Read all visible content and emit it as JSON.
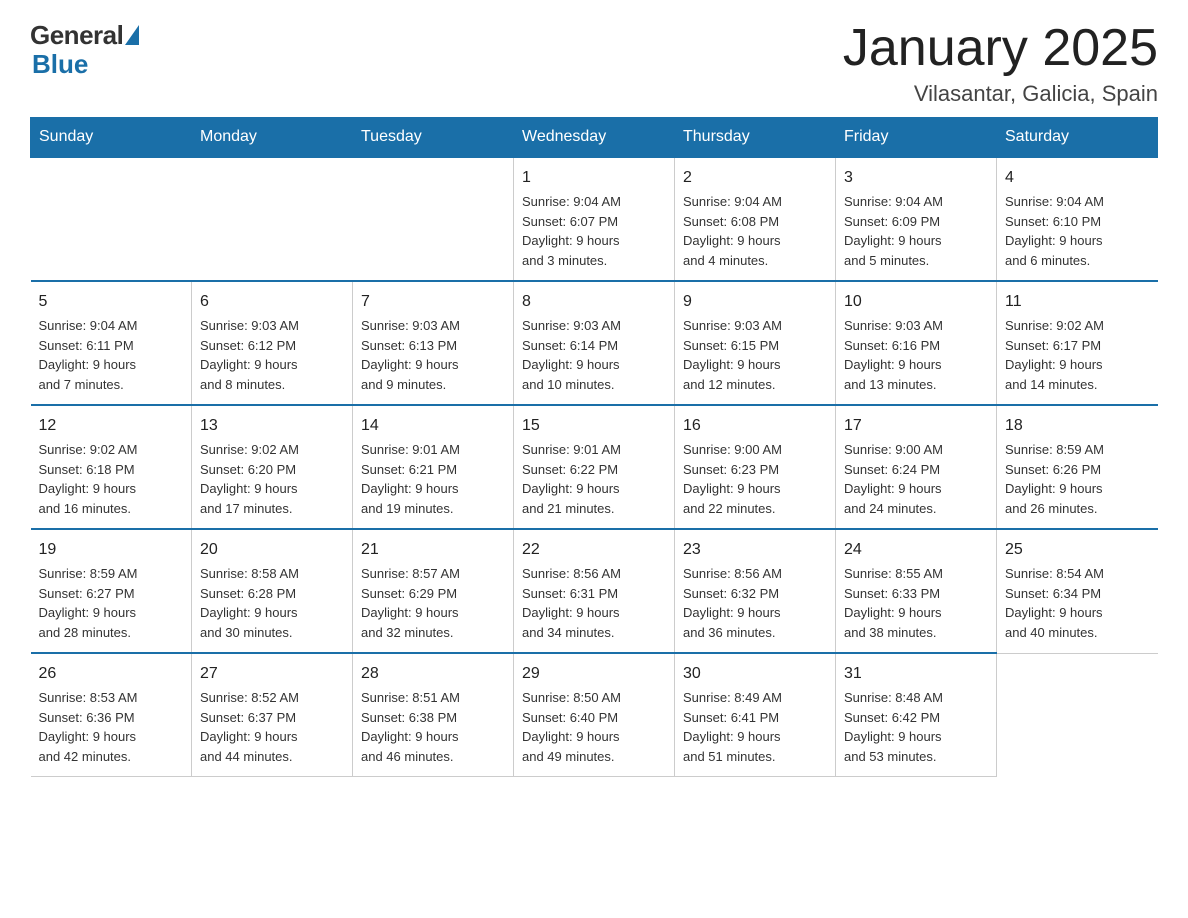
{
  "logo": {
    "general": "General",
    "blue": "Blue"
  },
  "title": "January 2025",
  "subtitle": "Vilasantar, Galicia, Spain",
  "days_of_week": [
    "Sunday",
    "Monday",
    "Tuesday",
    "Wednesday",
    "Thursday",
    "Friday",
    "Saturday"
  ],
  "weeks": [
    [
      {
        "day": "",
        "info": ""
      },
      {
        "day": "",
        "info": ""
      },
      {
        "day": "",
        "info": ""
      },
      {
        "day": "1",
        "info": "Sunrise: 9:04 AM\nSunset: 6:07 PM\nDaylight: 9 hours\nand 3 minutes."
      },
      {
        "day": "2",
        "info": "Sunrise: 9:04 AM\nSunset: 6:08 PM\nDaylight: 9 hours\nand 4 minutes."
      },
      {
        "day": "3",
        "info": "Sunrise: 9:04 AM\nSunset: 6:09 PM\nDaylight: 9 hours\nand 5 minutes."
      },
      {
        "day": "4",
        "info": "Sunrise: 9:04 AM\nSunset: 6:10 PM\nDaylight: 9 hours\nand 6 minutes."
      }
    ],
    [
      {
        "day": "5",
        "info": "Sunrise: 9:04 AM\nSunset: 6:11 PM\nDaylight: 9 hours\nand 7 minutes."
      },
      {
        "day": "6",
        "info": "Sunrise: 9:03 AM\nSunset: 6:12 PM\nDaylight: 9 hours\nand 8 minutes."
      },
      {
        "day": "7",
        "info": "Sunrise: 9:03 AM\nSunset: 6:13 PM\nDaylight: 9 hours\nand 9 minutes."
      },
      {
        "day": "8",
        "info": "Sunrise: 9:03 AM\nSunset: 6:14 PM\nDaylight: 9 hours\nand 10 minutes."
      },
      {
        "day": "9",
        "info": "Sunrise: 9:03 AM\nSunset: 6:15 PM\nDaylight: 9 hours\nand 12 minutes."
      },
      {
        "day": "10",
        "info": "Sunrise: 9:03 AM\nSunset: 6:16 PM\nDaylight: 9 hours\nand 13 minutes."
      },
      {
        "day": "11",
        "info": "Sunrise: 9:02 AM\nSunset: 6:17 PM\nDaylight: 9 hours\nand 14 minutes."
      }
    ],
    [
      {
        "day": "12",
        "info": "Sunrise: 9:02 AM\nSunset: 6:18 PM\nDaylight: 9 hours\nand 16 minutes."
      },
      {
        "day": "13",
        "info": "Sunrise: 9:02 AM\nSunset: 6:20 PM\nDaylight: 9 hours\nand 17 minutes."
      },
      {
        "day": "14",
        "info": "Sunrise: 9:01 AM\nSunset: 6:21 PM\nDaylight: 9 hours\nand 19 minutes."
      },
      {
        "day": "15",
        "info": "Sunrise: 9:01 AM\nSunset: 6:22 PM\nDaylight: 9 hours\nand 21 minutes."
      },
      {
        "day": "16",
        "info": "Sunrise: 9:00 AM\nSunset: 6:23 PM\nDaylight: 9 hours\nand 22 minutes."
      },
      {
        "day": "17",
        "info": "Sunrise: 9:00 AM\nSunset: 6:24 PM\nDaylight: 9 hours\nand 24 minutes."
      },
      {
        "day": "18",
        "info": "Sunrise: 8:59 AM\nSunset: 6:26 PM\nDaylight: 9 hours\nand 26 minutes."
      }
    ],
    [
      {
        "day": "19",
        "info": "Sunrise: 8:59 AM\nSunset: 6:27 PM\nDaylight: 9 hours\nand 28 minutes."
      },
      {
        "day": "20",
        "info": "Sunrise: 8:58 AM\nSunset: 6:28 PM\nDaylight: 9 hours\nand 30 minutes."
      },
      {
        "day": "21",
        "info": "Sunrise: 8:57 AM\nSunset: 6:29 PM\nDaylight: 9 hours\nand 32 minutes."
      },
      {
        "day": "22",
        "info": "Sunrise: 8:56 AM\nSunset: 6:31 PM\nDaylight: 9 hours\nand 34 minutes."
      },
      {
        "day": "23",
        "info": "Sunrise: 8:56 AM\nSunset: 6:32 PM\nDaylight: 9 hours\nand 36 minutes."
      },
      {
        "day": "24",
        "info": "Sunrise: 8:55 AM\nSunset: 6:33 PM\nDaylight: 9 hours\nand 38 minutes."
      },
      {
        "day": "25",
        "info": "Sunrise: 8:54 AM\nSunset: 6:34 PM\nDaylight: 9 hours\nand 40 minutes."
      }
    ],
    [
      {
        "day": "26",
        "info": "Sunrise: 8:53 AM\nSunset: 6:36 PM\nDaylight: 9 hours\nand 42 minutes."
      },
      {
        "day": "27",
        "info": "Sunrise: 8:52 AM\nSunset: 6:37 PM\nDaylight: 9 hours\nand 44 minutes."
      },
      {
        "day": "28",
        "info": "Sunrise: 8:51 AM\nSunset: 6:38 PM\nDaylight: 9 hours\nand 46 minutes."
      },
      {
        "day": "29",
        "info": "Sunrise: 8:50 AM\nSunset: 6:40 PM\nDaylight: 9 hours\nand 49 minutes."
      },
      {
        "day": "30",
        "info": "Sunrise: 8:49 AM\nSunset: 6:41 PM\nDaylight: 9 hours\nand 51 minutes."
      },
      {
        "day": "31",
        "info": "Sunrise: 8:48 AM\nSunset: 6:42 PM\nDaylight: 9 hours\nand 53 minutes."
      },
      {
        "day": "",
        "info": ""
      }
    ]
  ]
}
